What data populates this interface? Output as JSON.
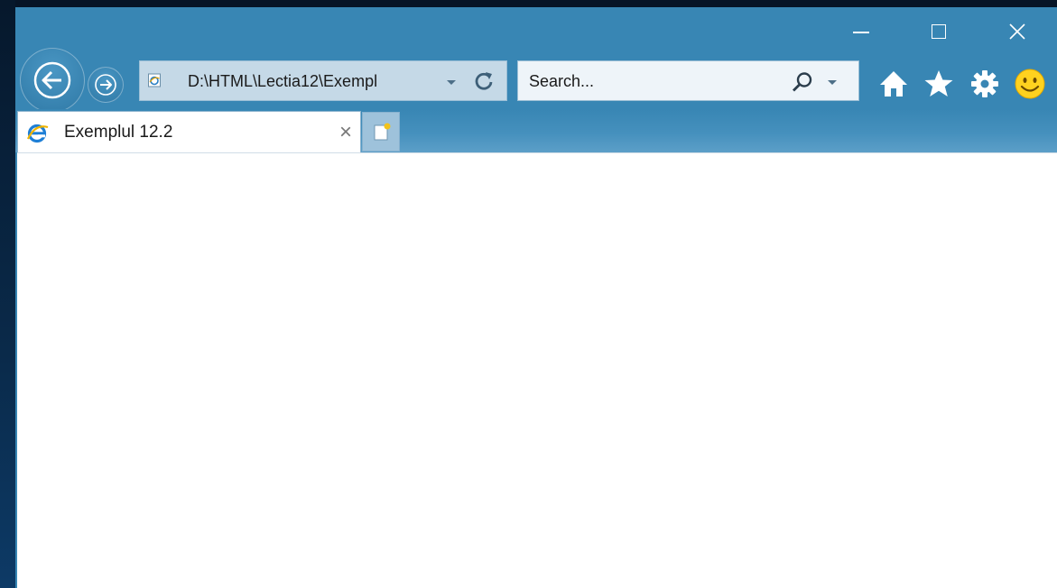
{
  "window": {
    "caption_buttons": {
      "minimize_icon": "minimize-icon",
      "maximize_icon": "maximize-icon",
      "close_icon": "close-icon"
    },
    "chrome_color": "#3886b4"
  },
  "navigation": {
    "back_icon": "arrow-left-icon",
    "forward_icon": "arrow-right-icon"
  },
  "address_bar": {
    "url": "D:\\HTML\\Lectia12\\Exempl",
    "page_icon": "ie-page-icon",
    "dropdown_icon": "chevron-down-icon",
    "refresh_icon": "refresh-icon"
  },
  "search": {
    "placeholder": "Search...",
    "search_icon": "magnifier-icon",
    "dropdown_icon": "chevron-down-icon"
  },
  "toolbar": {
    "icons": [
      "home-icon",
      "star-icon",
      "gear-icon",
      "smiley-icon"
    ]
  },
  "tabs": [
    {
      "title": "Exemplul 12.2",
      "favicon": "ie-logo-icon",
      "close_label": "×",
      "active": true
    }
  ],
  "new_tab": {
    "icon": "new-tab-icon"
  }
}
